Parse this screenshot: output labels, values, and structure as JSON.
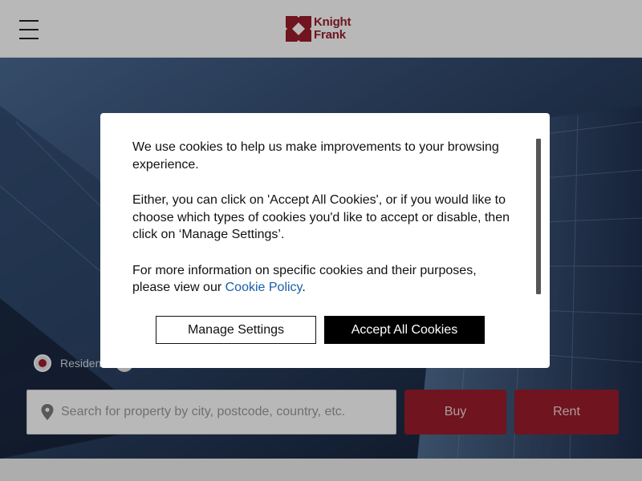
{
  "header": {
    "menu_icon": "hamburger-menu-icon",
    "logo": {
      "line1": "Knight",
      "line2": "Frank",
      "brand_color": "#9b1c2c"
    }
  },
  "search_panel": {
    "radio_selected_label": "Residen",
    "input_placeholder": "Search for property by city, postcode, country, etc.",
    "location_icon": "map-pin-icon",
    "buy_label": "Buy",
    "rent_label": "Rent",
    "button_color": "#9b1c2c"
  },
  "cookie_modal": {
    "paragraph1": "We use cookies to help us make improvements to your browsing experience.",
    "paragraph2": "Either, you can click on 'Accept All Cookies', or if you would like to choose which types of cookies you'd like to accept or disable, then click on ‘Manage Settings’.",
    "paragraph3_prefix": "For more information on specific cookies and their purposes, please view our ",
    "policy_link": "Cookie Policy",
    "paragraph3_suffix": ".",
    "manage_label": "Manage Settings",
    "accept_label": "Accept All Cookies"
  }
}
